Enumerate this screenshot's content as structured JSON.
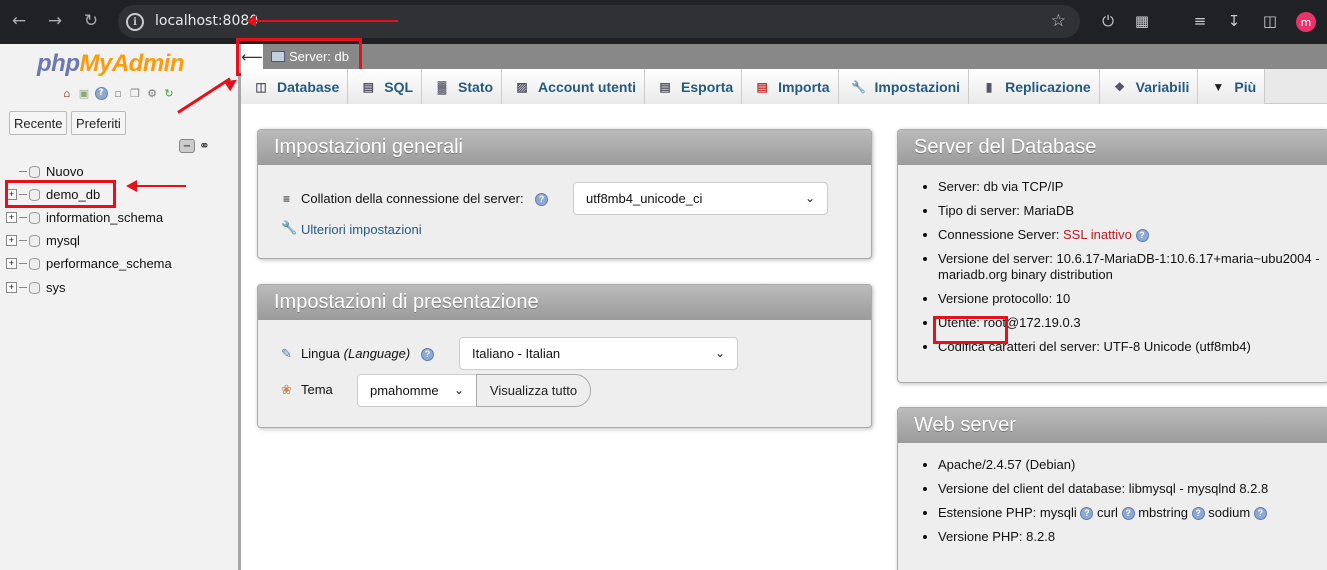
{
  "browser": {
    "url": "localhost:8080",
    "profile_initial": "m"
  },
  "nav": {
    "logo_php": "php",
    "logo_myadmin": "MyAdmin",
    "recent_label": "Recente",
    "favorites_label": "Preferiti",
    "tree": [
      {
        "label": "Nuovo",
        "icon": "new-database-icon"
      },
      {
        "label": "demo_db"
      },
      {
        "label": "information_schema"
      },
      {
        "label": "mysql"
      },
      {
        "label": "performance_schema"
      },
      {
        "label": "sys"
      }
    ]
  },
  "breadcrumb": {
    "server_label": "Server: db"
  },
  "tabs": [
    {
      "label": "Database",
      "icon": "database-icon"
    },
    {
      "label": "SQL",
      "icon": "sql-icon"
    },
    {
      "label": "Stato",
      "icon": "status-icon"
    },
    {
      "label": "Account utenti",
      "icon": "users-icon"
    },
    {
      "label": "Esporta",
      "icon": "export-icon"
    },
    {
      "label": "Importa",
      "icon": "import-icon"
    },
    {
      "label": "Impostazioni",
      "icon": "wrench-icon"
    },
    {
      "label": "Replicazione",
      "icon": "replication-icon"
    },
    {
      "label": "Variabili",
      "icon": "variables-icon"
    },
    {
      "label": "Più",
      "icon": "dropdown-icon"
    }
  ],
  "general": {
    "title": "Impostazioni generali",
    "collation_label": "Collation della connessione del server:",
    "collation_value": "utf8mb4_unicode_ci",
    "more_settings": "Ulteriori impostazioni"
  },
  "presentation": {
    "title": "Impostazioni di presentazione",
    "language_label": "Lingua",
    "language_label_en": "(Language)",
    "language_value": "Italiano - Italian",
    "theme_label": "Tema",
    "theme_value": "pmahomme",
    "view_all": "Visualizza tutto"
  },
  "db_server": {
    "title": "Server del Database",
    "items": [
      "Server: db via TCP/IP",
      "Tipo di server: MariaDB",
      "Connessione Server: ",
      "Versione del server: 10.6.17-MariaDB-1:10.6.17+maria~ubu2004 - mariadb.org binary distribution",
      "Versione protocollo: 10",
      "Utente: root@172.19.0.3",
      "Codifica caratteri del server: UTF-8 Unicode (utf8mb4)"
    ],
    "ssl_status": "SSL inattivo"
  },
  "web_server": {
    "title": "Web server",
    "items": [
      "Apache/2.4.57 (Debian)",
      "Versione del client del database: libmysql - mysqlnd 8.2.8",
      "Estensione PHP: mysqli",
      "Versione PHP: 8.2.8"
    ],
    "php_ext": [
      "curl",
      "mbstring",
      "sodium"
    ]
  },
  "colors": {
    "annotation": "#e6101a",
    "tab_text": "#235a81",
    "ssl_text": "#bc1a25"
  }
}
